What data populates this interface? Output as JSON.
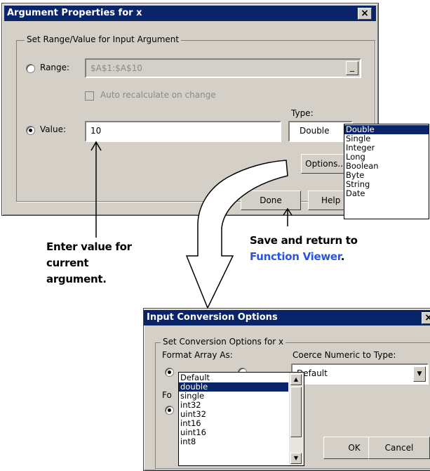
{
  "arg_dialog": {
    "title": "Argument Properties for x",
    "close_glyph": "×",
    "group_label": "Set Range/Value for Input Argument",
    "range_radio_label": "Range:",
    "range_value": "$A$1:$A$10",
    "browse_glyph": "_",
    "auto_recalc_label": "Auto recalculate on change",
    "type_label": "Type:",
    "value_radio_label": "Value:",
    "value_input": "10",
    "type_selected": "Double",
    "options_button": "Options...",
    "done_button": "Done",
    "help_button": "Help"
  },
  "type_dropdown": {
    "items": [
      "Double",
      "Single",
      "Integer",
      "Long",
      "Boolean",
      "Byte",
      "String",
      "Date"
    ],
    "selected_index": 0
  },
  "annotations": {
    "enter_value": [
      "Enter value for",
      "current",
      "argument."
    ],
    "save_return_line1": "Save and return to",
    "save_return_link": "Function Viewer",
    "save_return_tail": "."
  },
  "conv_dialog": {
    "title": "Input Conversion Options",
    "close_glyph": "×",
    "group_label": "Set Conversion Options for x",
    "format_array_label": "Format Array As:",
    "coerce_label": "Coerce Numeric to Type:",
    "coerce_selected": "Default",
    "format_prefix": "Fo",
    "ok_button": "OK",
    "cancel_button": "Cancel"
  },
  "coerce_dropdown": {
    "items": [
      "Default",
      "double",
      "single",
      "int32",
      "uint32",
      "int16",
      "uint16",
      "int8"
    ],
    "selected_index": 1
  },
  "colors": {
    "titlebar": "#0a246a",
    "dialog_face": "#d4d0c8",
    "link_blue": "#2a53e8"
  }
}
